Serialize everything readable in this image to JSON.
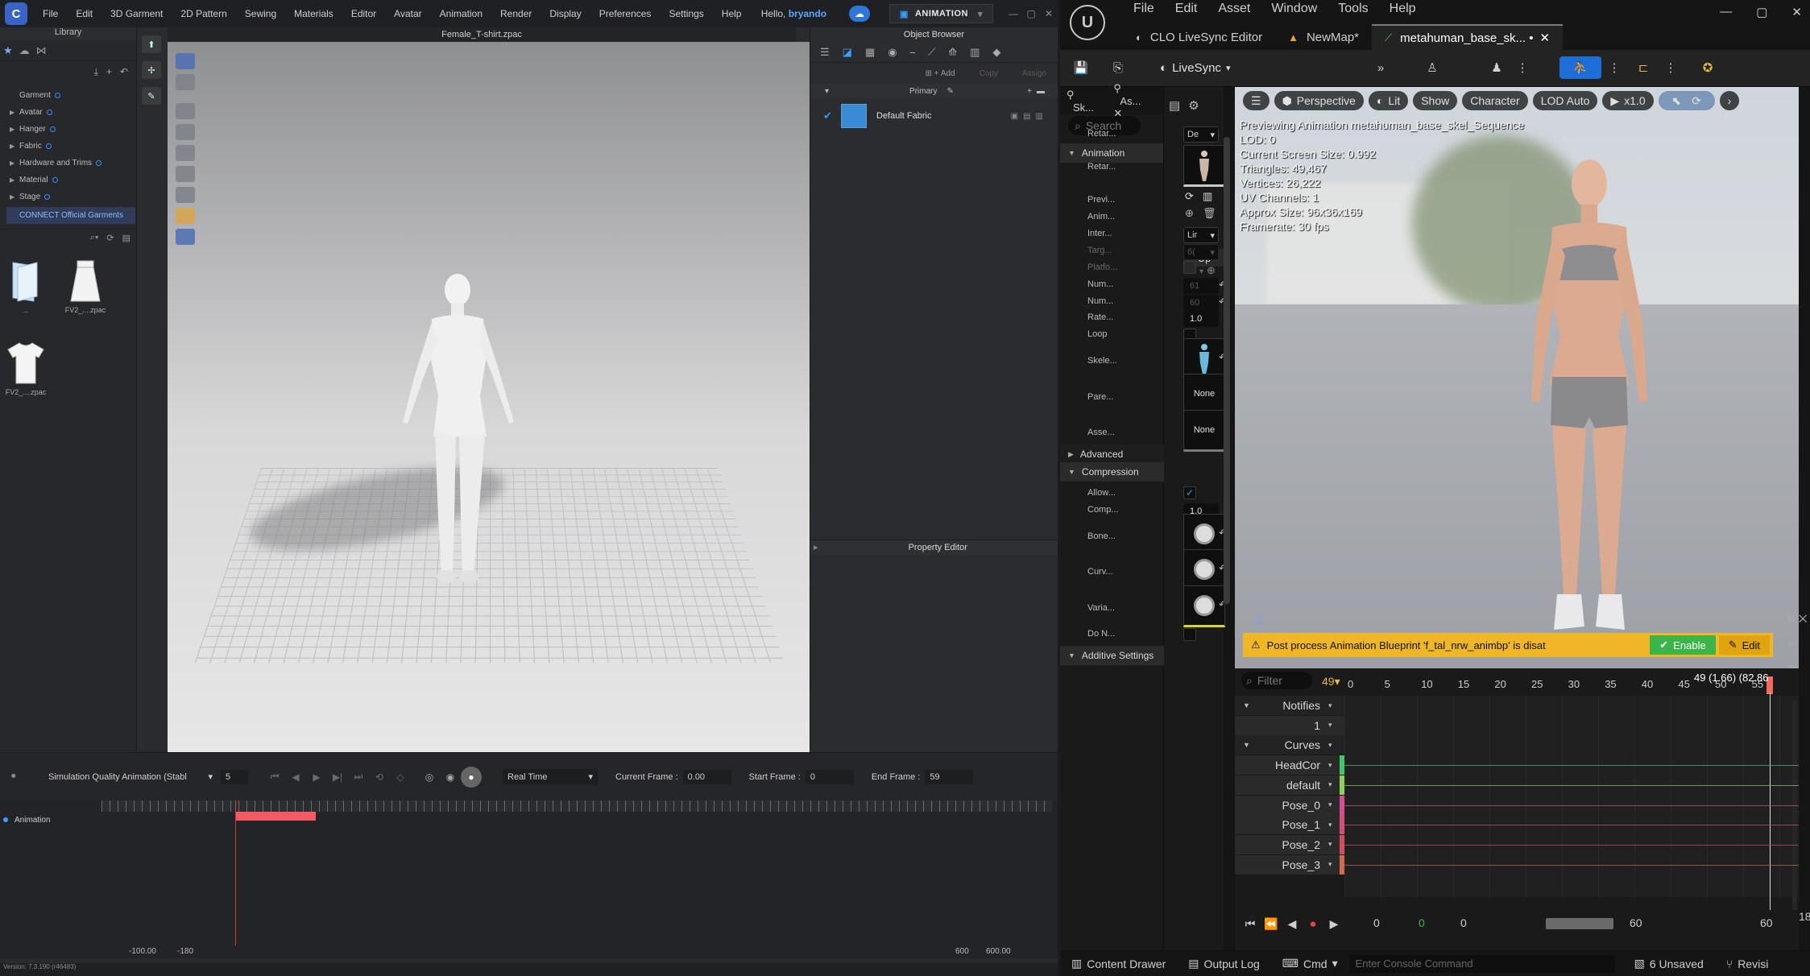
{
  "clo": {
    "menu": [
      "File",
      "Edit",
      "3D Garment",
      "2D Pattern",
      "Sewing",
      "Materials",
      "Editor",
      "Avatar",
      "Animation",
      "Render",
      "Display",
      "Preferences",
      "Settings",
      "Help"
    ],
    "hello_prefix": "Hello, ",
    "username": "bryando",
    "mode_label": "ANIMATION",
    "library": {
      "title": "Library",
      "tree": [
        "Garment",
        "Avatar",
        "Hanger",
        "Fabric",
        "Hardware and Trims",
        "Material",
        "Stage"
      ],
      "connect": "CONNECT Official Garments",
      "thumbs": [
        {
          "label": "..",
          "icon": "folder"
        },
        {
          "label": "FV2_....zpac",
          "icon": "skirt"
        },
        {
          "label": "FV2_....zpac",
          "icon": "tshirt"
        }
      ]
    },
    "viewport_title": "Female_T-shirt.zpac",
    "object_browser": {
      "title": "Object Browser",
      "add": "Add",
      "copy": "Copy",
      "assign": "Assign",
      "tab": "Primary",
      "fabric": "Default Fabric",
      "fabric_color": "#3a8ad4"
    },
    "property_editor": "Property Editor",
    "anim": {
      "quality": "Simulation Quality Animation (Stabl",
      "steps": "5",
      "speed": "Real Time",
      "current_label": "Current Frame :",
      "current": "0.00",
      "start_label": "Start Frame :",
      "start": "0",
      "end_label": "End Frame :",
      "end": "59",
      "track": "Animation",
      "range_left_a": "-100.00",
      "range_left_b": "-180",
      "range_right_a": "600",
      "range_right_b": "600.00"
    },
    "version": "Version: 7.3.190 (r46483)"
  },
  "ue": {
    "menu": [
      "File",
      "Edit",
      "Asset",
      "Window",
      "Tools",
      "Help"
    ],
    "tabs": [
      {
        "label": "CLO LiveSync Editor",
        "icon": "livesync"
      },
      {
        "label": "NewMap*",
        "icon": "map"
      },
      {
        "label": "metahuman_base_sk... •",
        "icon": "anim"
      }
    ],
    "livesync": "LiveSync",
    "details": {
      "tab1": "Sk...",
      "tab2": "As...",
      "search": "Search",
      "sec_animation": "Animation",
      "sec_advanced": "Advanced",
      "sec_compression": "Compression",
      "sec_additive": "Additive Settings",
      "labels": {
        "retar1": "Retar...",
        "retar2": "Retar...",
        "previ": "Previ...",
        "anim": "Anim...",
        "inter": "Inter...",
        "targ": "Targ...",
        "platfo": "Platfo...",
        "num1": "Num...",
        "num2": "Num...",
        "rate": "Rate...",
        "loop": "Loop",
        "skele": "Skele...",
        "pare": "Pare...",
        "asse": "Asse...",
        "allow": "Allow...",
        "comp": "Comp...",
        "bone": "Bone...",
        "curv": "Curv...",
        "varia": "Varia...",
        "don": "Do N..."
      },
      "values": {
        "retarget_combo": "De",
        "up": "Up",
        "inter_combo": "Lir",
        "targ_combo": "6(",
        "num1": "61",
        "num2": "60",
        "rate": "1.0",
        "pare": "None",
        "asse": "None",
        "comp": "1.0",
        "allow_checked": "✓"
      }
    },
    "viewport": {
      "perspective": "Perspective",
      "lit": "Lit",
      "show": "Show",
      "character": "Character",
      "lod": "LOD Auto",
      "speed": "x1.0",
      "stats": [
        "Previewing Animation metahuman_base_skel_Sequence",
        "LOD: 0",
        "Current Screen Size: 0.992",
        "Triangles: 49,467",
        "Vertices: 26,222",
        "UV Channels: 1",
        "Approx Size: 96x36x169",
        "Framerate: 30 fps"
      ],
      "warning": "Post process Animation Blueprint 'f_tal_nrw_animbp' is disat",
      "enable": "Enable",
      "edit": "Edit",
      "axis": "Z"
    },
    "seq": {
      "filter": "Filter",
      "frame": "49",
      "playhead": "49 (1.66) (82.86",
      "ticks": [
        "0",
        "5",
        "10",
        "15",
        "20",
        "25",
        "30",
        "35",
        "40",
        "45",
        "50",
        "55"
      ],
      "tracks": [
        {
          "name": "Notifies",
          "kind": "h",
          "color": ""
        },
        {
          "name": "1",
          "kind": "v",
          "color": ""
        },
        {
          "name": "Curves",
          "kind": "h",
          "color": ""
        },
        {
          "name": "HeadCor",
          "kind": "v",
          "color": "#44c46a"
        },
        {
          "name": "default",
          "kind": "v",
          "color": "#8ccf5a"
        },
        {
          "name": "Pose_0",
          "kind": "v",
          "color": "#d24e93"
        },
        {
          "name": "Pose_1",
          "kind": "v",
          "color": "#d24e7c"
        },
        {
          "name": "Pose_2",
          "kind": "v",
          "color": "#cf4f5f"
        },
        {
          "name": "Pose_3",
          "kind": "v",
          "color": "#cf6a4f"
        }
      ],
      "pb_vals": [
        "0",
        "0",
        "0",
        "60",
        "",
        "60"
      ],
      "right_num": "18("
    },
    "status": {
      "content_drawer": "Content Drawer",
      "output_log": "Output Log",
      "cmd": "Cmd",
      "console_placeholder": "Enter Console Command",
      "unsaved": "6 Unsaved",
      "revision": "Revisi"
    }
  }
}
